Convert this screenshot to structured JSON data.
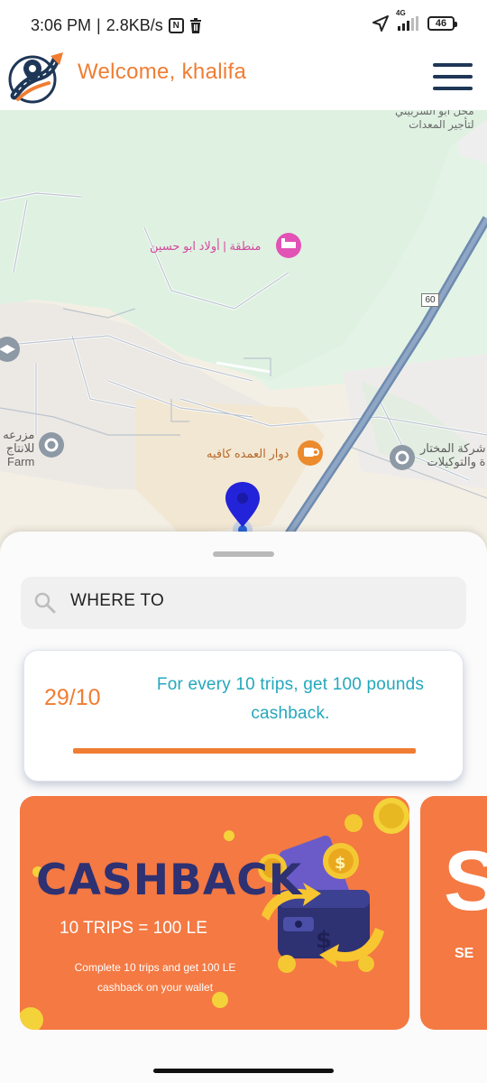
{
  "status_bar": {
    "time": "3:06 PM",
    "net_speed": "2.8KB/s",
    "nfc_icon": "nfc-icon",
    "network_type": "4G",
    "battery": "46"
  },
  "header": {
    "welcome": "Welcome, khalifa",
    "logo_icon": "route-logo-icon",
    "menu_icon": "hamburger-menu-icon"
  },
  "map": {
    "labels": {
      "top_right_1": "محل ابو الشربيني",
      "top_right_2": "لتأجير المعدات",
      "place_pink": "منطقة | أولاد ابو حسين",
      "cafe": "دوار العمده كافيه",
      "farm_ar_1": "مزرعه",
      "farm_ar_2": "للانتاج",
      "farm_en": "Farm",
      "company_1": "شركة المختار",
      "company_2": "ة والتوكيلات",
      "road_number": "60"
    }
  },
  "sheet": {
    "search_placeholder": "WHERE TO",
    "promo": {
      "count": "29/10",
      "text": "For every 10 trips, get 100 pounds cashback.",
      "progress": 1.0
    },
    "banners": [
      {
        "title": "CASHBACK",
        "subtitle": "10 TRIPS = 100 LE",
        "description": "Complete 10 trips and get 100 LE cashback on your wallet"
      },
      {
        "big_letter": "S",
        "label": "SE"
      }
    ]
  },
  "colors": {
    "accent_orange": "#f07d33",
    "navy": "#1f3757",
    "teal": "#23a7bd",
    "banner_orange": "#f47943",
    "pin_blue": "#2323d9"
  }
}
